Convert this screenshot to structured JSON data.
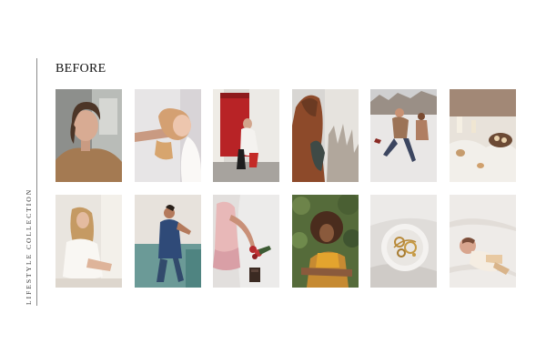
{
  "side_label": "LIFESTYLE COLLECTION",
  "heading": "BEFORE",
  "photos": [
    {
      "subject": "woman-portrait-camel-coat"
    },
    {
      "subject": "woman-leaning-back-blonde"
    },
    {
      "subject": "woman-sitting-red-door"
    },
    {
      "subject": "woman-brown-coat-dried-flowers"
    },
    {
      "subject": "couple-playing-in-snow"
    },
    {
      "subject": "candles-and-cups-on-linen"
    },
    {
      "subject": "blonde-woman-white-outfit-sitting"
    },
    {
      "subject": "woman-denim-teal-wall"
    },
    {
      "subject": "woman-pink-dress-flowers"
    },
    {
      "subject": "curly-hair-woman-yellow-top"
    },
    {
      "subject": "gold-jewelry-on-plate"
    },
    {
      "subject": "baby-on-white-blanket"
    }
  ]
}
